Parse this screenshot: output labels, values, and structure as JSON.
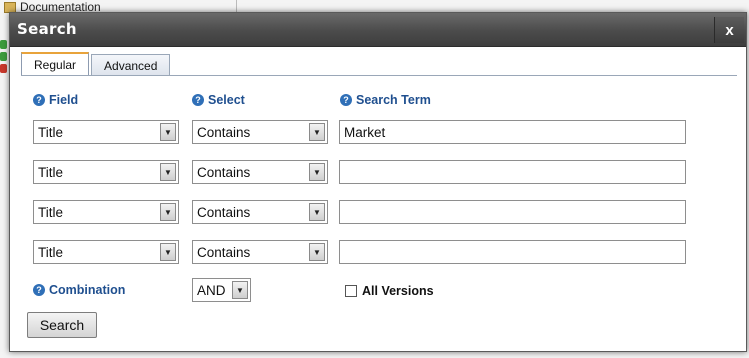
{
  "background": {
    "tree_item_label": "Documentation"
  },
  "dialog": {
    "title": "Search",
    "close_label": "x"
  },
  "tabs": [
    {
      "label": "Regular",
      "active": true
    },
    {
      "label": "Advanced",
      "active": false
    }
  ],
  "headers": {
    "field": "Field",
    "select": "Select",
    "search_term": "Search Term",
    "help_glyph": "?"
  },
  "rows": [
    {
      "field": "Title",
      "operator": "Contains",
      "term": "Market"
    },
    {
      "field": "Title",
      "operator": "Contains",
      "term": ""
    },
    {
      "field": "Title",
      "operator": "Contains",
      "term": ""
    },
    {
      "field": "Title",
      "operator": "Contains",
      "term": ""
    }
  ],
  "combination": {
    "label": "Combination",
    "value": "AND"
  },
  "all_versions": {
    "label": "All Versions",
    "checked": false
  },
  "search_button_label": "Search",
  "colors": {
    "titlebar": "#4b4b4b",
    "header_text": "#1f4f8f",
    "help_icon": "#2f6fb7",
    "active_tab_accent": "#e8a33b"
  }
}
